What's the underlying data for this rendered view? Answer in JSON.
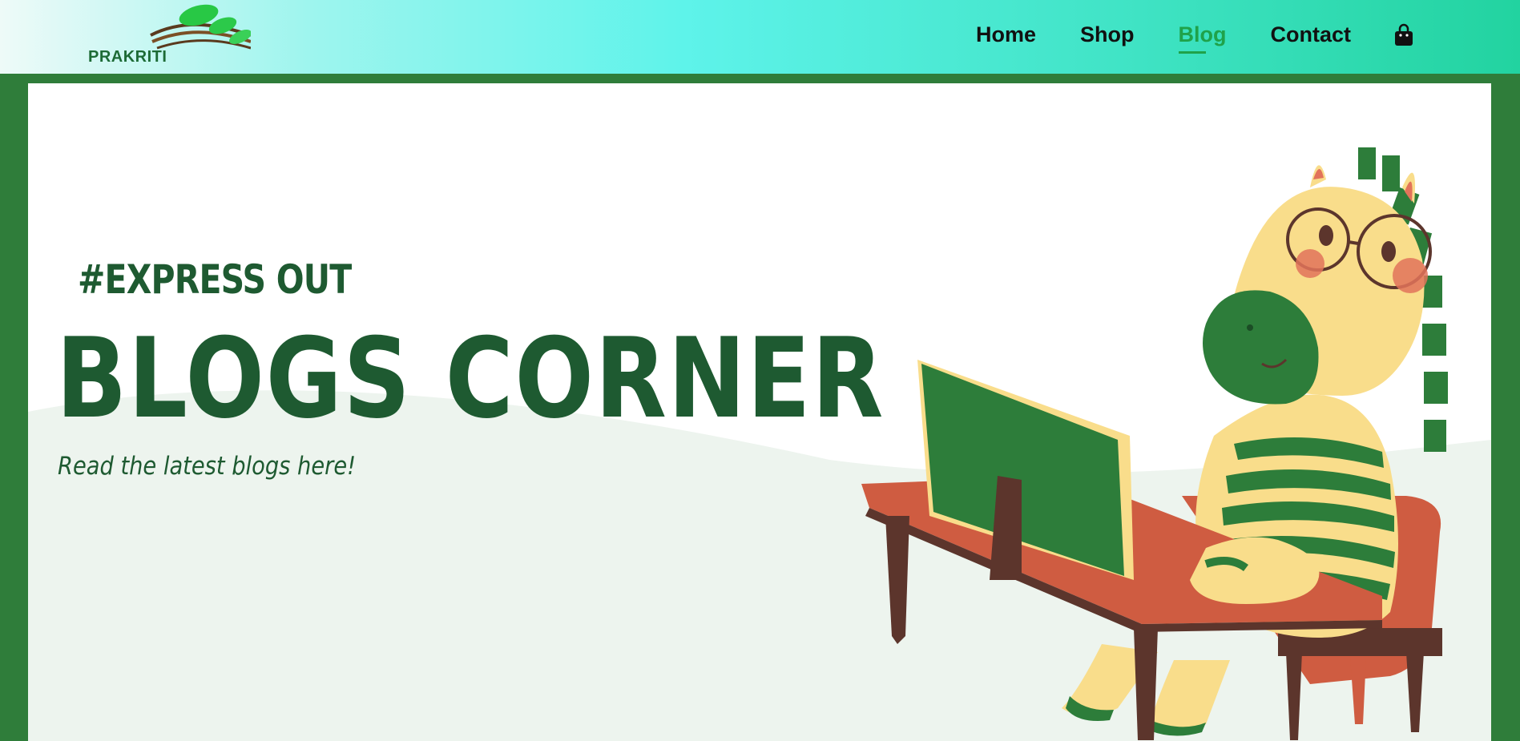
{
  "header": {
    "logo_text": "PRAKRITI",
    "nav": [
      {
        "label": "Home"
      },
      {
        "label": "Shop"
      },
      {
        "label": "Blog"
      },
      {
        "label": "Contact"
      }
    ],
    "active_nav": "Blog",
    "cart_icon": "shopping-bag-icon"
  },
  "hero": {
    "tag": "#EXPRESS OUT",
    "title": "BLOGS CORNER",
    "subtitle": "Read the latest blogs here!"
  },
  "colors": {
    "primary_green": "#1e5a31",
    "frame_green": "#2f7d3a",
    "active_link": "#1fa24a",
    "header_gradient_start": "#eefaf8",
    "header_gradient_end": "#22d3a0"
  }
}
